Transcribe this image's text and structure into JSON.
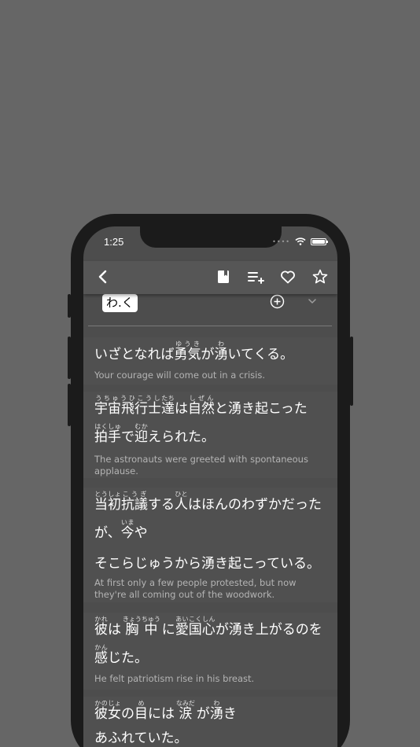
{
  "status_bar": {
    "time": "1:25"
  },
  "entry": {
    "reading_tag": "わ.く"
  },
  "sentences": [
    {
      "lines": [
        [
          {
            "t": "いざとなれば"
          },
          {
            "k": "勇気",
            "r": "ゆうき"
          },
          {
            "t": "が"
          },
          {
            "k": "湧",
            "r": "わ"
          },
          {
            "t": "いてくる。"
          }
        ]
      ],
      "english": "Your courage will come out in a crisis."
    },
    {
      "lines": [
        [
          {
            "k": "宇宙飛行士",
            "r": "うちゅうひこうし"
          },
          {
            "k": "達",
            "r": "たち"
          },
          {
            "t": "は"
          },
          {
            "k": "自然",
            "r": "しぜん"
          },
          {
            "t": "と湧き起こった"
          }
        ],
        [
          {
            "k": "拍手",
            "r": "はくしゅ"
          },
          {
            "t": "で"
          },
          {
            "k": "迎",
            "r": "むか"
          },
          {
            "t": "えられた。"
          }
        ]
      ],
      "english": "The astronauts were greeted with spontaneous applause."
    },
    {
      "lines": [
        [
          {
            "k": "当初",
            "r": "とうしょ"
          },
          {
            "k": "抗議",
            "r": "こうぎ"
          },
          {
            "t": "する"
          },
          {
            "k": "人",
            "r": "ひと"
          },
          {
            "t": "はほんのわずかだった"
          }
        ],
        [
          {
            "t": "が、"
          },
          {
            "k": "今",
            "r": "いま"
          },
          {
            "t": "や"
          }
        ],
        [
          {
            "t": "そこらじゅうから湧き起こっている。"
          }
        ]
      ],
      "english": "At first only a few people protested, but now they're all coming out of the woodwork."
    },
    {
      "lines": [
        [
          {
            "k": "彼",
            "r": "かれ"
          },
          {
            "t": "は "
          },
          {
            "k": "胸中",
            "r": "きょうちゅう"
          },
          {
            "t": " に"
          },
          {
            "k": "愛国心",
            "r": "あいこくしん"
          },
          {
            "t": "が湧き上がるのを"
          }
        ],
        [
          {
            "k": "感",
            "r": "かん"
          },
          {
            "t": "じた。"
          }
        ]
      ],
      "english": "He felt patriotism rise in his breast."
    },
    {
      "lines": [
        [
          {
            "k": "彼女",
            "r": "かのじょ"
          },
          {
            "t": "の"
          },
          {
            "k": "目",
            "r": "め"
          },
          {
            "t": "には "
          },
          {
            "k": "涙",
            "r": "なみだ"
          },
          {
            "t": " が"
          },
          {
            "k": "湧",
            "r": "わ"
          },
          {
            "t": "き"
          }
        ],
        [
          {
            "t": "あふれていた。"
          }
        ]
      ],
      "english": ""
    }
  ]
}
